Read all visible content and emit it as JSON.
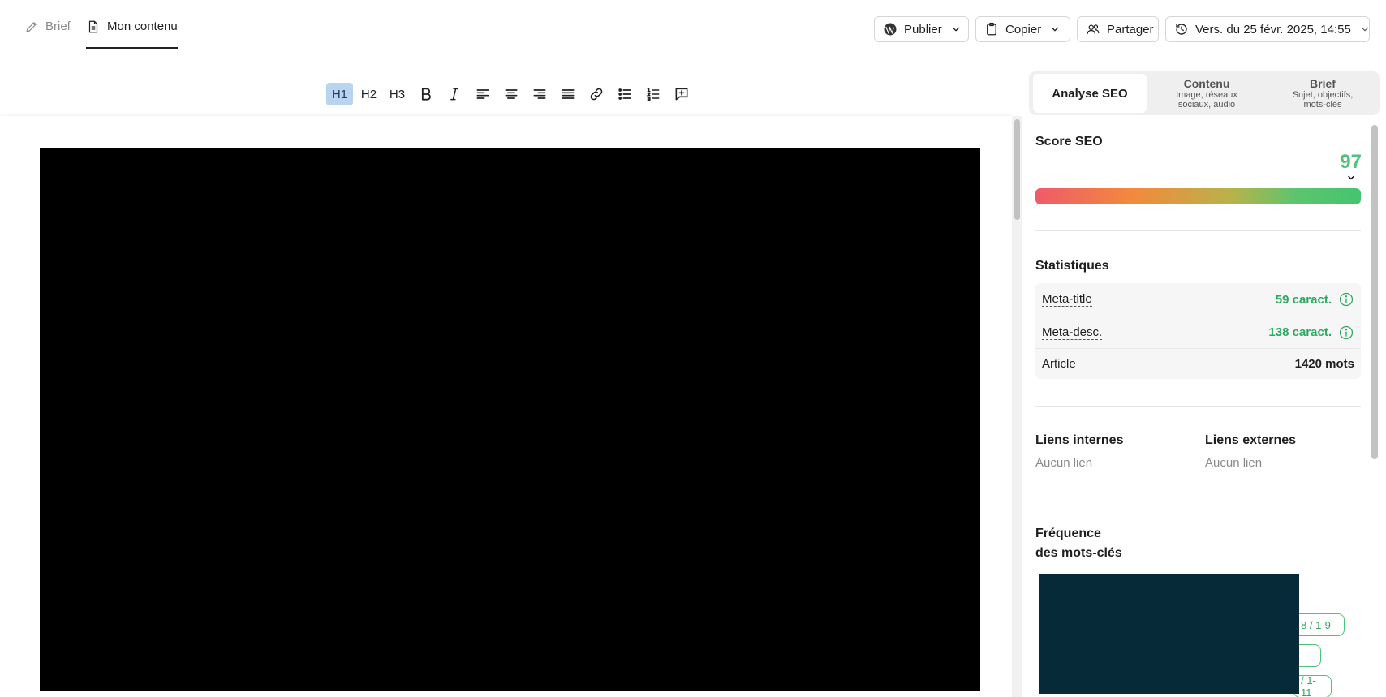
{
  "header": {
    "tabs": [
      {
        "label": "Brief",
        "icon": "pencil-icon",
        "active": false
      },
      {
        "label": "Mon contenu",
        "icon": "document-icon",
        "active": true
      }
    ],
    "actions": {
      "publish_label": "Publier",
      "copy_label": "Copier",
      "share_label": "Partager",
      "version_label": "Vers. du 25 févr. 2025, 14:55"
    }
  },
  "toolbar": {
    "h1": "H1",
    "h2": "H2",
    "h3": "H3",
    "active_heading": "H1"
  },
  "panel": {
    "tabs": [
      {
        "title": "Analyse SEO",
        "subtitle": ""
      },
      {
        "title": "Contenu",
        "subtitle": "Image, réseaux sociaux, audio"
      },
      {
        "title": "Brief",
        "subtitle": "Sujet, objectifs, mots-clés"
      }
    ],
    "score": {
      "title": "Score SEO",
      "value": "97"
    },
    "stats": {
      "title": "Statistiques",
      "rows": [
        {
          "label": "Meta-title",
          "value": "59 caract."
        },
        {
          "label": "Meta-desc.",
          "value": "138 caract."
        },
        {
          "label": "Article",
          "value": "1420 mots"
        }
      ]
    },
    "links": {
      "internal_title": "Liens internes",
      "internal_value": "Aucun lien",
      "external_title": "Liens externes",
      "external_value": "Aucun lien"
    },
    "keywords": {
      "title_line1": "Fréquence",
      "title_line2": "des mots-clés",
      "pills": [
        "8 / 1-9",
        "",
        "/ 1-11"
      ]
    }
  },
  "colors": {
    "accent_green": "#4cc27d",
    "active_tool_bg": "#b8d4f0",
    "keyword_block": "#062a38"
  }
}
